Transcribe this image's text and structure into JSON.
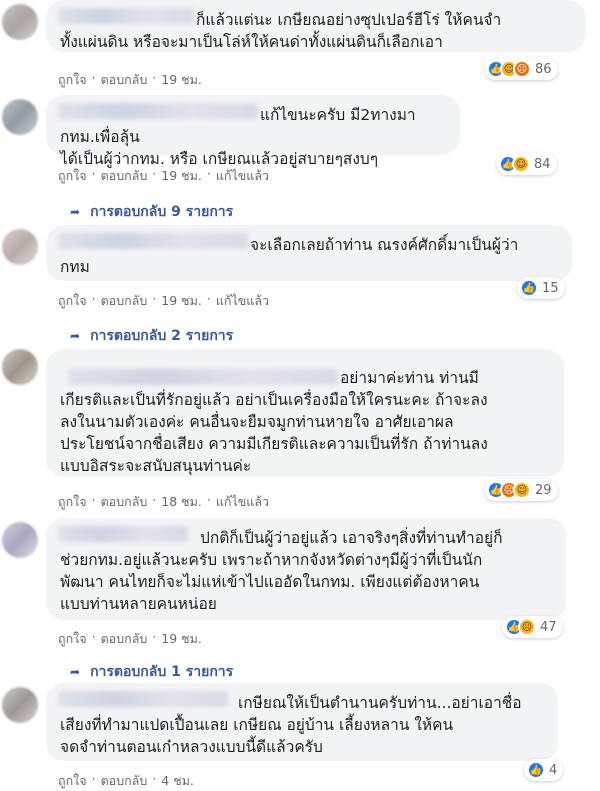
{
  "colors": {
    "bubble": "#f2f3f5",
    "link": "#385898",
    "meta": "#65676b",
    "like": "#1877f2"
  },
  "comments": [
    {
      "text": "ก็แล้วแต่นะ เกษียณอย่างซุปเปอร์ฮีโร่ ให้คนจำ\nทั้งแผ่นดิน หรือจะมาเป็นโล่ห์ให้คนด่าทั้งแผ่นดินก็เลือกเอา",
      "actions": {
        "like": "ถูกใจ",
        "reply": "ตอบกลับ",
        "time": "19 ชม."
      },
      "reactions": [
        "like-icon",
        "haha-icon",
        "angry-icon"
      ],
      "count": "86"
    },
    {
      "text": "แก้ไขนะครับ มี2ทางมา กทม.เพื่อลุ้น\nได้เป็นผู้ว่ากทม. หรือ เกษียณแล้วอยู่สบายๆสงบๆ",
      "actions": {
        "like": "ถูกใจ",
        "reply": "ตอบกลับ",
        "time": "19 ชม.",
        "edited": "แก้ไขแล้ว"
      },
      "reactions": [
        "like-icon",
        "haha-icon"
      ],
      "count": "84",
      "replies": "การตอบกลับ 9 รายการ"
    },
    {
      "text": "จะเลือกเลยถ้าท่าน ณรงค์ศักดิ์มาเป็นผู้ว่า\nกทม",
      "actions": {
        "like": "ถูกใจ",
        "reply": "ตอบกลับ",
        "time": "19 ชม.",
        "edited": "แก้ไขแล้ว"
      },
      "reactions": [
        "like-icon"
      ],
      "count": "15",
      "replies": "การตอบกลับ 2 รายการ"
    },
    {
      "text": "อย่ามาค่ะท่าน ท่านมี\nเกียรติและเป็นที่รักอยู่แล้ว อย่าเป็นเครื่องมือให้ใครนะคะ ถ้าจะลง\nลงในนามตัวเองค่ะ คนอื่นจะยืมจมูกท่านหายใจ อาศัยเอาผล\nประโยชน์จากชื่อเสียง ความมีเกียรติและความเป็นที่รัก ถ้าท่านลง\nแบบอิสระจะสนับสนุนท่านค่ะ",
      "actions": {
        "like": "ถูกใจ",
        "reply": "ตอบกลับ",
        "time": "18 ชม.",
        "edited": "แก้ไขแล้ว"
      },
      "reactions": [
        "like-icon",
        "angry-icon",
        "haha-icon"
      ],
      "count": "29"
    },
    {
      "text": "ปกติก็เป็นผู้ว่าอยู่แล้ว เอาจริงๆสิ่งที่ท่านทำอยู่ก็\nช่วยกทม.อยู่แล้วนะครับ เพราะถ้าหากจังหวัดต่างๆมีผู้ว่าที่เป็นนัก\nพัฒนา คนไทยก็จะไม่แห่เข้าไปแออัดในกทม. เพียงแต่ต้องหาคน\nแบบท่านหลายคนหน่อย",
      "actions": {
        "like": "ถูกใจ",
        "reply": "ตอบกลับ",
        "time": "19 ชม."
      },
      "reactions": [
        "like-icon",
        "sad-icon"
      ],
      "count": "47",
      "replies": "การตอบกลับ 1 รายการ"
    },
    {
      "text": "เกษียณให้เป็นตำนานครับท่าน...อย่าเอาชื่อ\nเสียงที่ทำมาแปดเปื้อนเลย เกษียณ อยู่บ้าน เลี้ยงหลาน ให้คน\nจดจำท่านตอนเก๋าหลวงแบบนี้ดีแล้วครับ",
      "actions": {
        "like": "ถูกใจ",
        "reply": "ตอบกลับ",
        "time": "4 ชม."
      },
      "reactions": [
        "like-icon"
      ],
      "count": "4"
    }
  ]
}
